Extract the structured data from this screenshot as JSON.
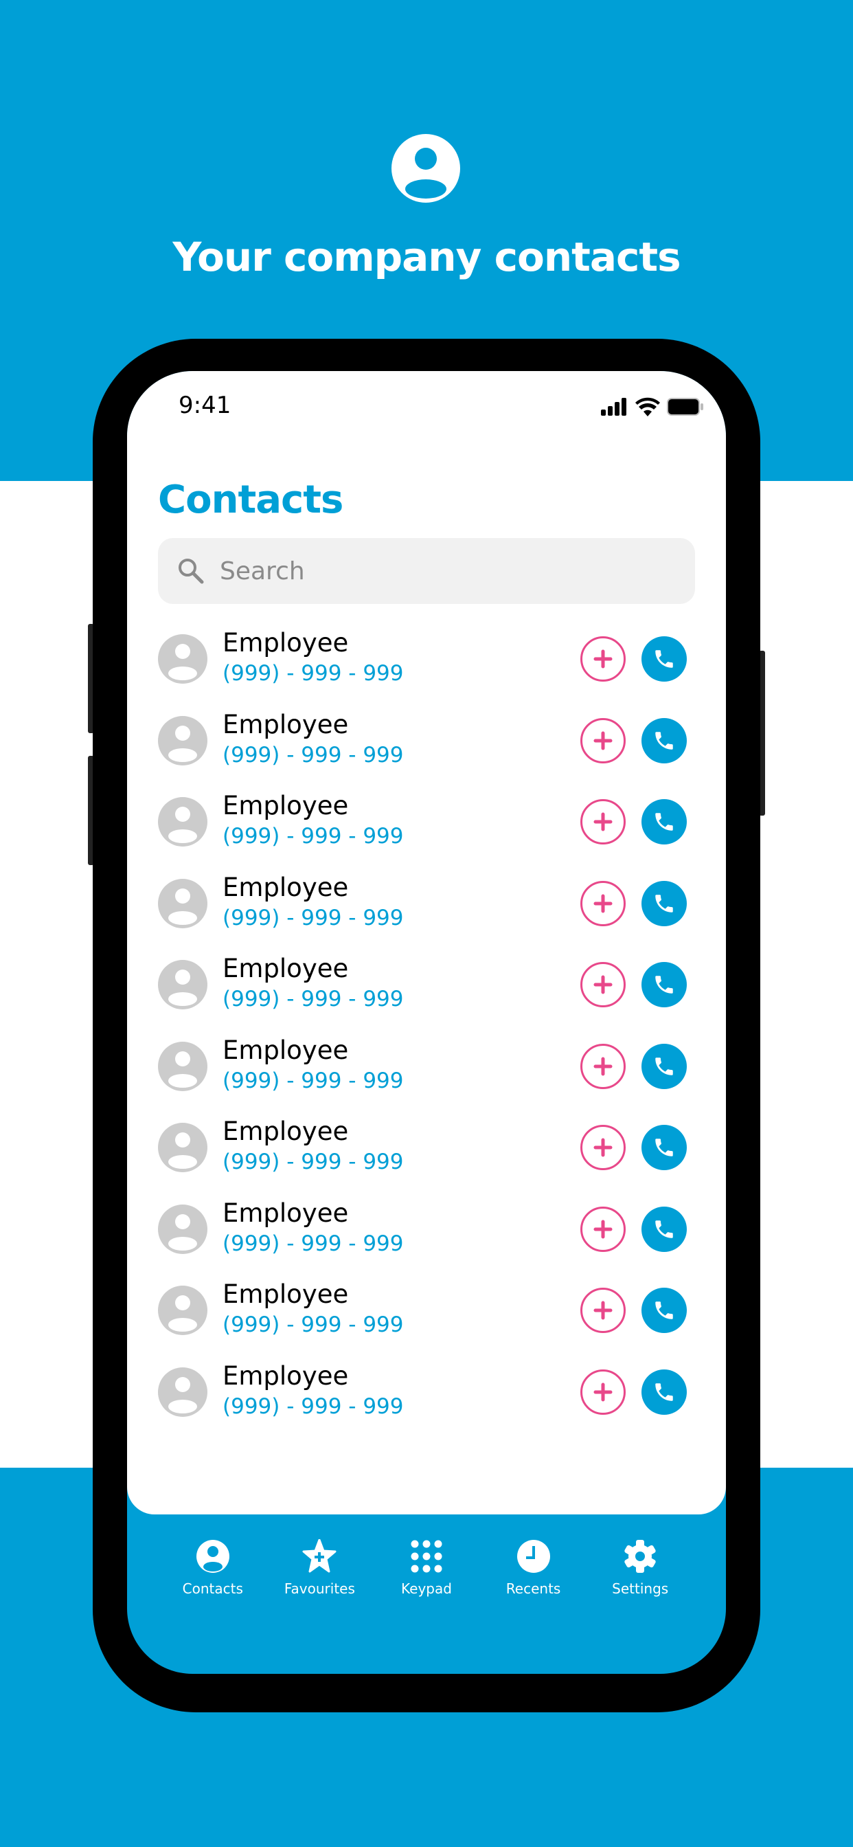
{
  "promo": {
    "title": "Your company contacts",
    "icon": "user-circle-icon"
  },
  "status_bar": {
    "time": "9:41"
  },
  "page": {
    "title": "Contacts"
  },
  "search": {
    "placeholder": "Search"
  },
  "contacts": [
    {
      "name": "Employee",
      "phone": "(999) - 999 - 999"
    },
    {
      "name": "Employee",
      "phone": "(999) - 999 - 999"
    },
    {
      "name": "Employee",
      "phone": "(999) - 999 - 999"
    },
    {
      "name": "Employee",
      "phone": "(999) - 999 - 999"
    },
    {
      "name": "Employee",
      "phone": "(999) - 999 - 999"
    },
    {
      "name": "Employee",
      "phone": "(999) - 999 - 999"
    },
    {
      "name": "Employee",
      "phone": "(999) - 999 - 999"
    },
    {
      "name": "Employee",
      "phone": "(999) - 999 - 999"
    },
    {
      "name": "Employee",
      "phone": "(999) - 999 - 999"
    },
    {
      "name": "Employee",
      "phone": "(999) - 999 - 999"
    }
  ],
  "tabs": [
    {
      "label": "Contacts",
      "icon": "user-circle-icon"
    },
    {
      "label": "Favourites",
      "icon": "star-plus-icon"
    },
    {
      "label": "Keypad",
      "icon": "keypad-icon"
    },
    {
      "label": "Recents",
      "icon": "clock-icon"
    },
    {
      "label": "Settings",
      "icon": "gear-icon"
    }
  ],
  "colors": {
    "brand": "#009fd6",
    "accent": "#e8488a",
    "avatar": "#cccccc"
  }
}
